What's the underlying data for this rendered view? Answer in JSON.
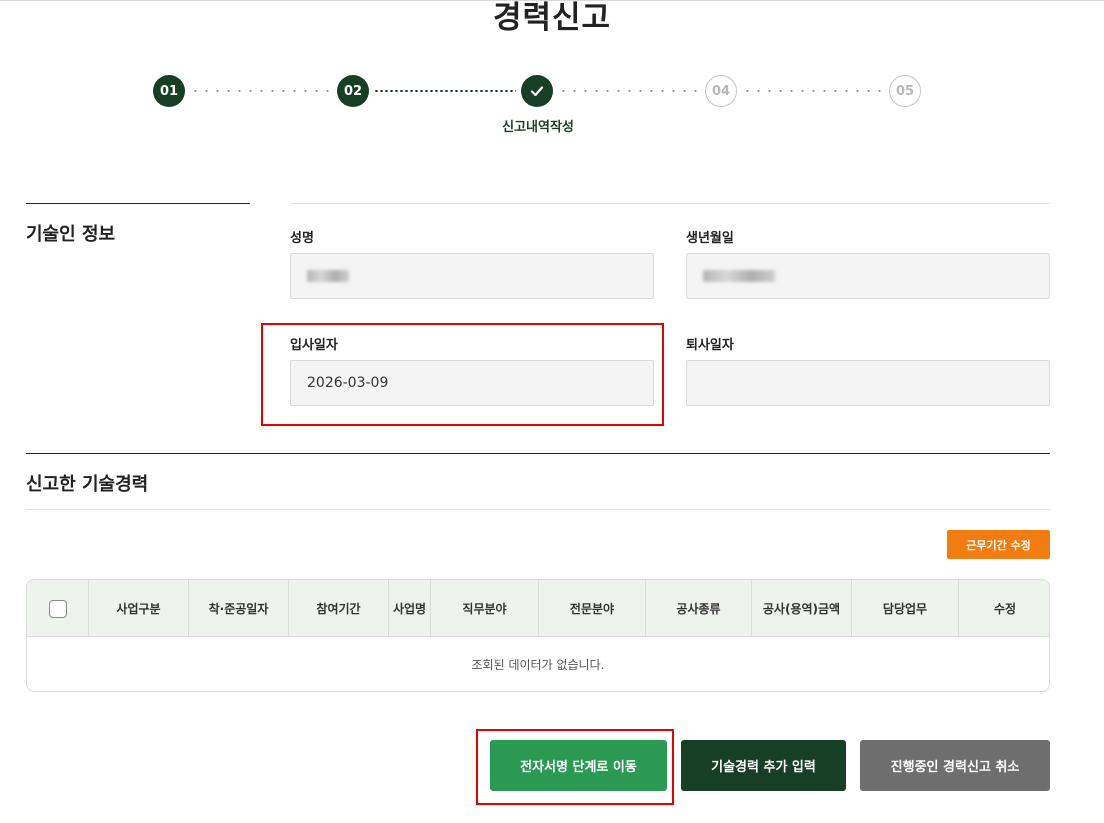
{
  "page": {
    "title": "경력신고"
  },
  "stepper": {
    "steps": [
      {
        "label": "01",
        "state": "done"
      },
      {
        "label": "02",
        "state": "done"
      },
      {
        "label": "",
        "state": "current",
        "icon": "check-icon"
      },
      {
        "label": "04",
        "state": "todo"
      },
      {
        "label": "05",
        "state": "todo"
      }
    ],
    "current_caption": "신고내역작성"
  },
  "engineer_info": {
    "title": "기술인 정보",
    "name_label": "성명",
    "birth_label": "생년월일",
    "hire_date_label": "입사일자",
    "hire_date_value": "2026-03-09",
    "leave_date_label": "퇴사일자",
    "leave_date_value": ""
  },
  "career_section": {
    "title": "신고한 기술경력",
    "edit_period_button": "근무기간 수정",
    "columns": [
      "사업구분",
      "착·준공일자",
      "참여기간",
      "사업명",
      "직무분야",
      "전문분야",
      "공사종류",
      "공사(용역)금액",
      "담당업무",
      "수정"
    ],
    "empty_message": "조회된 데이터가 없습니다."
  },
  "actions": {
    "sign_step": "전자서명 단계로 이동",
    "add_career": "기술경력 추가 입력",
    "cancel_report": "진행중인 경력신고 취소"
  },
  "colors": {
    "primary_dark": "#163f25",
    "primary_green": "#2a9a53",
    "accent_orange": "#f07c12",
    "highlight_red": "#e60000"
  }
}
